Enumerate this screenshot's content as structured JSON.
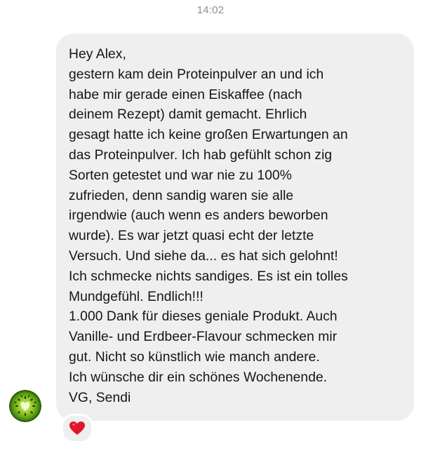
{
  "conversation": {
    "timestamp": "14:02",
    "message": {
      "lines": [
        "Hey Alex,",
        "gestern kam dein Proteinpulver an und ich",
        "habe mir gerade einen Eiskaffee (nach",
        "deinem Rezept) damit gemacht. Ehrlich",
        "gesagt hatte ich keine großen Erwartungen an",
        "das Proteinpulver. Ich hab gefühlt schon zig",
        "Sorten getestet und war nie zu 100%",
        "zufrieden, denn sandig waren sie alle",
        "irgendwie (auch wenn es anders beworben",
        "wurde). Es war jetzt quasi echt der letzte",
        "Versuch. Und siehe da... es hat sich gelohnt!",
        "Ich schmecke nichts sandiges. Es ist ein tolles",
        "Mundgefühl. Endlich!!!",
        "1.000 Dank für dieses geniale Produkt. Auch",
        "Vanille- und Erdbeer-Flavour schmecken mir",
        "gut. Nicht so künstlich wie manch andere.",
        "Ich wünsche dir ein schönes Wochenende.",
        "VG, Sendi"
      ],
      "reaction": "heart"
    },
    "sender_avatar": "kiwi-heart-avatar"
  },
  "colors": {
    "bubble": "#efeff0",
    "timestamp": "#8e8e93",
    "reaction_heart": "#e0162b"
  }
}
